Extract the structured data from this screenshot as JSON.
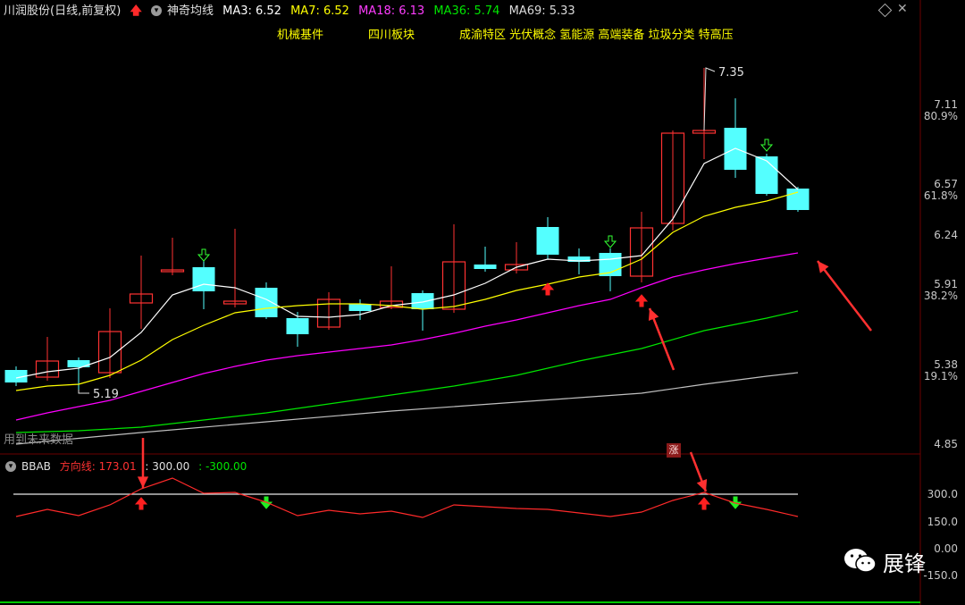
{
  "header": {
    "stock": "川润股份",
    "period": "(日线,前复权)",
    "indicator_name": "神奇均线",
    "ma3": "MA3: 6.52",
    "ma7": "MA7: 6.52",
    "ma18": "MA18: 6.13",
    "ma36": "MA36: 5.74",
    "ma69": "MA69: 5.33"
  },
  "concepts": [
    "机械基件",
    "四川板块",
    "成渝特区 光伏概念 氢能源 高端装备 垃圾分类 特高压"
  ],
  "price_axis": [
    {
      "label": "7.11"
    },
    {
      "label": "80.9%"
    },
    {
      "label": "6.57"
    },
    {
      "label": "61.8%"
    },
    {
      "label": "6.24"
    },
    {
      "label": "5.91"
    },
    {
      "label": "38.2%"
    },
    {
      "label": "5.38"
    },
    {
      "label": "19.1%"
    },
    {
      "label": "4.85"
    }
  ],
  "annotations": {
    "high": "7.35",
    "low": "5.19",
    "future_note": "用到未来数据",
    "limit_badge": "涨"
  },
  "indicator": {
    "name": "BBAB",
    "direction": "方向线: 173.01",
    "upper": ": 300.00",
    "lower": ": -300.00",
    "axis": [
      "300.0",
      "150.0",
      "0.00",
      "-150.0"
    ]
  },
  "watermark": "展锋",
  "colors": {
    "up": "#ff3232",
    "down": "#54ffff",
    "ma3": "#ffffff",
    "ma7": "#ffff00",
    "ma18": "#ff00ff",
    "ma36": "#00e600",
    "ma69": "#c0c0c0",
    "bg": "#000000"
  }
}
